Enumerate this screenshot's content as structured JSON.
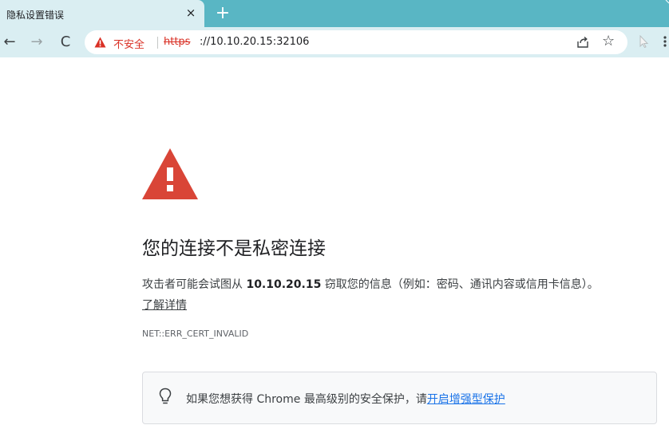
{
  "tab": {
    "title": "隐私设置错误",
    "close_glyph": "×",
    "new_tab_glyph": "+"
  },
  "toolbar": {
    "back_glyph": "←",
    "forward_glyph": "→",
    "reload_glyph": "C",
    "security_label": "不安全",
    "url_scheme": "https",
    "url_rest": "://10.10.20.15:32106",
    "bookmark_glyph": "☆"
  },
  "page": {
    "heading": "您的连接不是私密连接",
    "explain_before": "攻击者可能会试图从 ",
    "explain_host": "10.10.20.15",
    "explain_after": " 窃取您的信息（例如：密码、通讯内容或信用卡信息）。",
    "learn_more": "了解详情",
    "error_code": "NET::ERR_CERT_INVALID",
    "enhanced_text": "如果您想获得 Chrome 最高级别的安全保护，请",
    "enhanced_link": "开启增强型保护"
  },
  "colors": {
    "tab_strip": "#59b6c4",
    "toolbar": "#daeef2",
    "danger_red": "#d93025",
    "warning_triangle": "#d94537",
    "link_blue": "#1a73e8"
  },
  "icons": [
    "close-icon",
    "new-tab-icon",
    "back-arrow-icon",
    "forward-arrow-icon",
    "reload-icon",
    "warning-icon",
    "share-icon",
    "star-icon",
    "extension-icon",
    "menu-icon",
    "lightbulb-icon"
  ]
}
